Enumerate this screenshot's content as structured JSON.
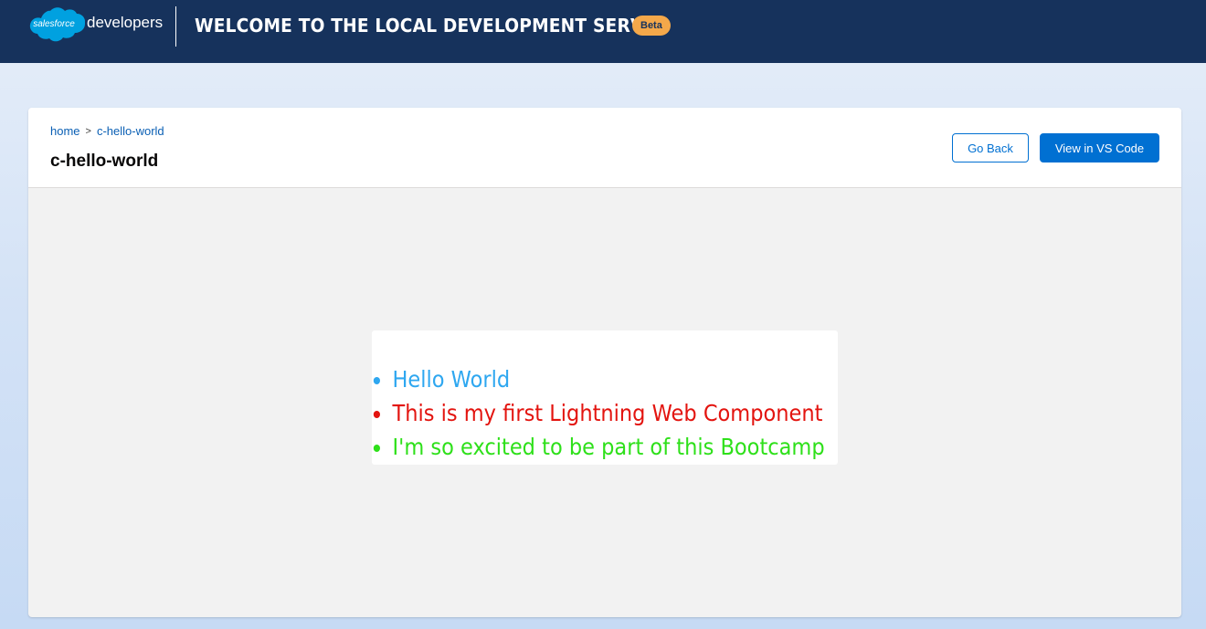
{
  "header": {
    "logo_brand": "salesforce",
    "logo_text": "developers",
    "title": "WELCOME TO THE LOCAL DEVELOPMENT SERVER",
    "badge": "Beta"
  },
  "card": {
    "breadcrumb": [
      {
        "label": "home"
      },
      {
        "label": "c-hello-world"
      }
    ],
    "breadcrumb_separator": ">",
    "title": "c-hello-world",
    "buttons": {
      "go_back": "Go Back",
      "view_vscode": "View in VS Code"
    }
  },
  "component": {
    "items": [
      {
        "text": "Hello World",
        "color": "#2ea7f0"
      },
      {
        "text": "This is my first Lightning Web Component",
        "color": "#e3140f"
      },
      {
        "text": "I'm so excited to be part of this Bootcamp",
        "color": "#2ee01a"
      }
    ]
  },
  "colors": {
    "header_bg": "#16325c",
    "brand_button": "#0070d2",
    "badge_bg": "#f4a84a",
    "cloud": "#00a1e0"
  }
}
